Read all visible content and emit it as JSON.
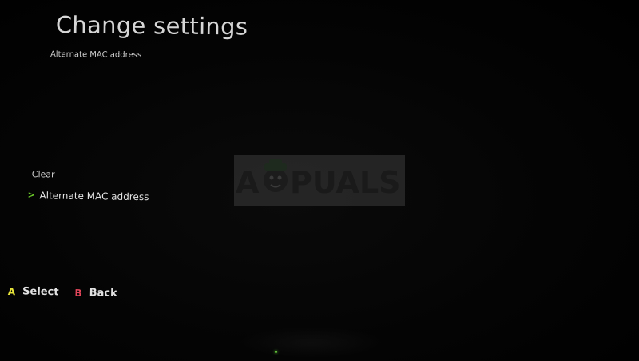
{
  "header": {
    "title": "Change settings",
    "subtitle": "Alternate MAC address"
  },
  "menu": {
    "items": [
      {
        "label": "Clear",
        "selected": false
      },
      {
        "label": "Alternate MAC address",
        "selected": true
      }
    ]
  },
  "footer": {
    "select": {
      "glyph": "A",
      "label": "Select",
      "color": "#e6e33a"
    },
    "back": {
      "glyph": "B",
      "label": "Back",
      "color": "#e2465a"
    }
  },
  "watermark": {
    "text_left": "A",
    "text_right": "PUALS"
  },
  "colors": {
    "background": "#000000",
    "text": "#d6d6d6",
    "accent_green": "#6ccb2a"
  },
  "icons": {
    "chevron": "chevron-right-icon",
    "mascot": "appuals-mascot-icon",
    "led": "status-led-icon"
  }
}
